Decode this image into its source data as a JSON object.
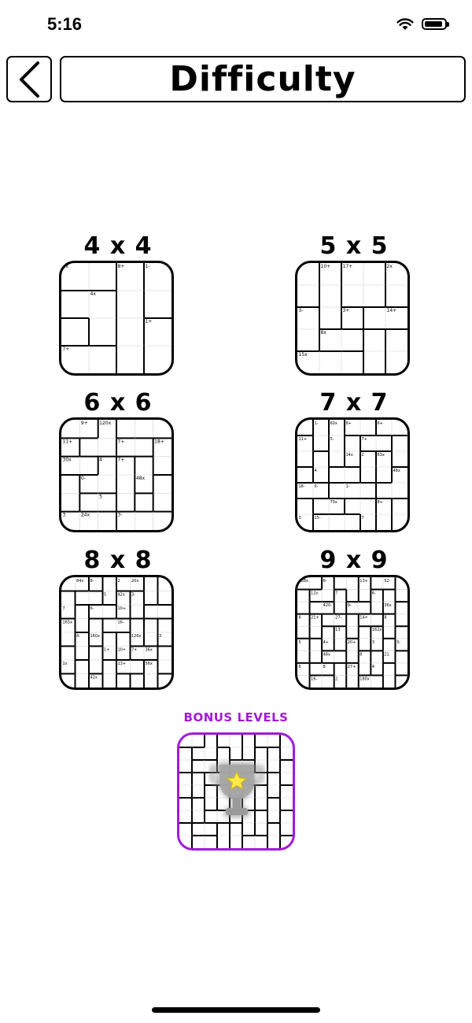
{
  "status_bar": {
    "time": "5:16",
    "wifi_icon": "wifi-icon",
    "battery_icon": "battery-icon"
  },
  "header": {
    "back_icon": "chevron-left-icon",
    "title": "Difficulty"
  },
  "levels": [
    {
      "label": "4 x 4",
      "clues": [
        "2x",
        "8+",
        "1-",
        "4x",
        "1+",
        "7+"
      ]
    },
    {
      "label": "5 x 5",
      "clues": [
        "10+",
        "17+",
        "2x",
        "3-",
        "3+",
        "14+",
        "8x",
        "15x"
      ]
    },
    {
      "label": "6 x 6",
      "clues": [
        "9+",
        "120x",
        "11+",
        "7+",
        "18+",
        "30x",
        "4",
        "7+",
        "0-",
        "48x",
        "5",
        "3",
        "24x",
        "3-"
      ]
    },
    {
      "label": "7 x 7",
      "clues": [
        "1-",
        "60x",
        "8+",
        "6+",
        "11+",
        "5-",
        "7+",
        "14x",
        "2",
        "63x",
        "4",
        "48x",
        "18-",
        "0-",
        "1-",
        "70x",
        "8+",
        "3",
        "15-",
        "7"
      ]
    },
    {
      "label": "8 x 8",
      "clues": [
        "84x",
        "8-",
        "2",
        "20x",
        "5",
        "42x",
        "3-",
        "6-",
        "7",
        "10+",
        "165x",
        "16-",
        "4-",
        "160x",
        "126x",
        "3",
        "1+",
        "10+",
        "7+",
        "36x",
        "1x",
        "13+",
        "56x",
        "42x"
      ]
    },
    {
      "label": "9 x 9",
      "clues": [
        "168x",
        "8-",
        "13+",
        "52-",
        "12x",
        "7",
        "6-",
        "420-",
        "9-",
        "36x",
        "8",
        "21+",
        "27-",
        "14+",
        "8",
        "13",
        "162x",
        "5",
        "4+",
        "20+",
        "3",
        "3-",
        "48x",
        "8",
        "21",
        "6",
        "8",
        "27+",
        "4",
        "16-",
        "2",
        "180x"
      ]
    }
  ],
  "bonus": {
    "label": "BONUS LEVELS",
    "trophy_icon": "trophy-icon"
  }
}
